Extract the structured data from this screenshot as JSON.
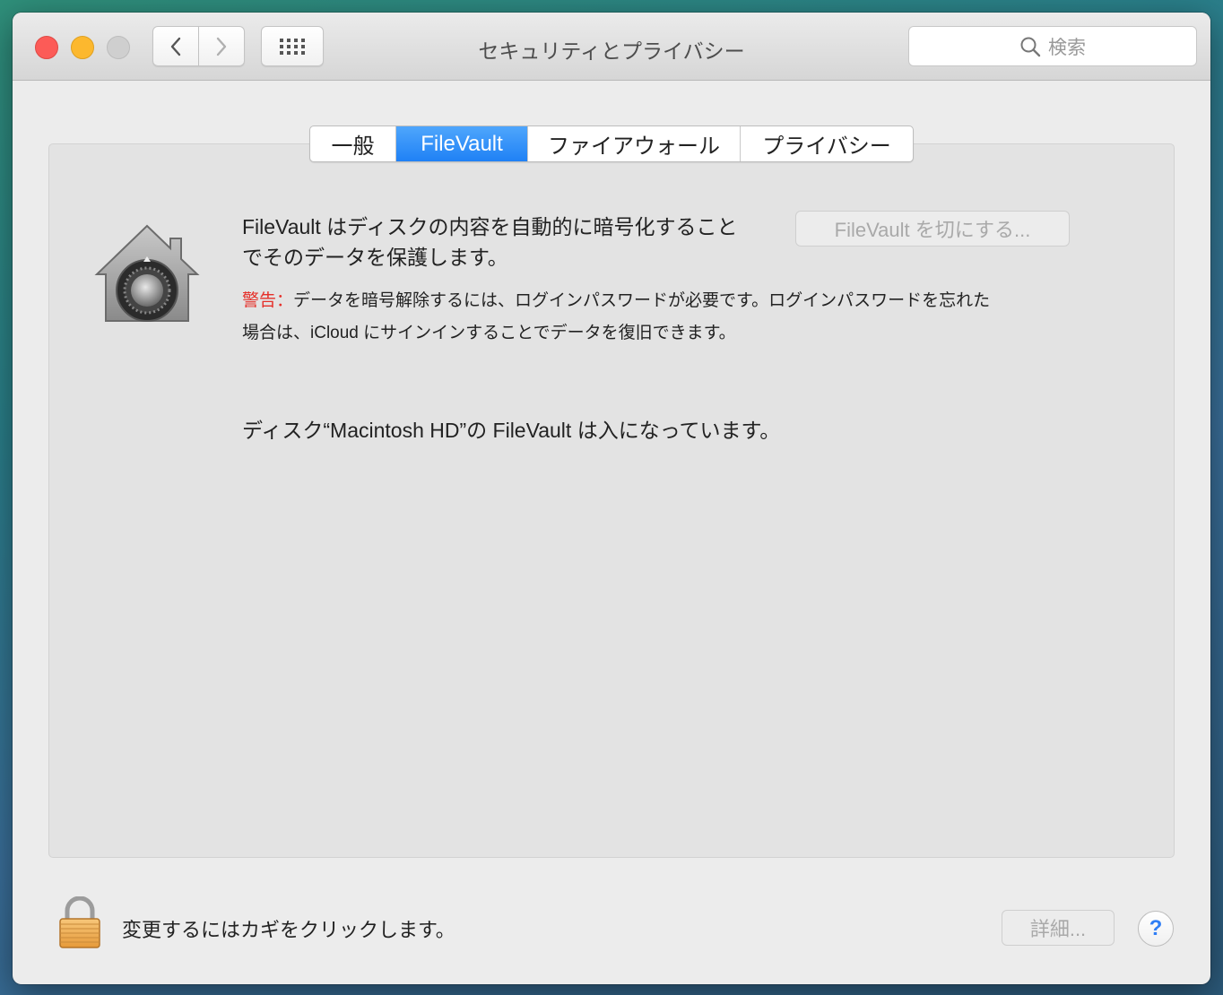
{
  "window": {
    "title": "セキュリティとプライバシー",
    "search_placeholder": "検索"
  },
  "tabs": [
    {
      "label": "一般",
      "active": false
    },
    {
      "label": "FileVault",
      "active": true
    },
    {
      "label": "ファイアウォール",
      "active": false
    },
    {
      "label": "プライバシー",
      "active": false
    }
  ],
  "filevault": {
    "description_line1": "FileVault はディスクの内容を自動的に暗号化すること",
    "description_line2": "でそのデータを保護します。",
    "warning_label": "警告：",
    "warning_line1": "データを暗号解除するには、ログインパスワードが必要です。ログインパスワードを忘れた",
    "warning_line2": "場合は、iCloud にサインインすることでデータを復旧できます。",
    "status": "ディスク“Macintosh HD”の FileVault は入になっています。",
    "turn_off_button": "FileVault を切にする..."
  },
  "footer": {
    "lock_text": "変更するにはカギをクリックします。",
    "advanced_button": "詳細...",
    "help_button": "?"
  },
  "icons": {
    "close": "close-icon",
    "minimize": "minimize-icon",
    "zoom": "zoom-icon",
    "back": "chevron-left-icon",
    "forward": "chevron-right-icon",
    "grid": "grid-icon",
    "search": "search-icon",
    "filevault": "filevault-house-icon",
    "padlock": "padlock-icon"
  }
}
